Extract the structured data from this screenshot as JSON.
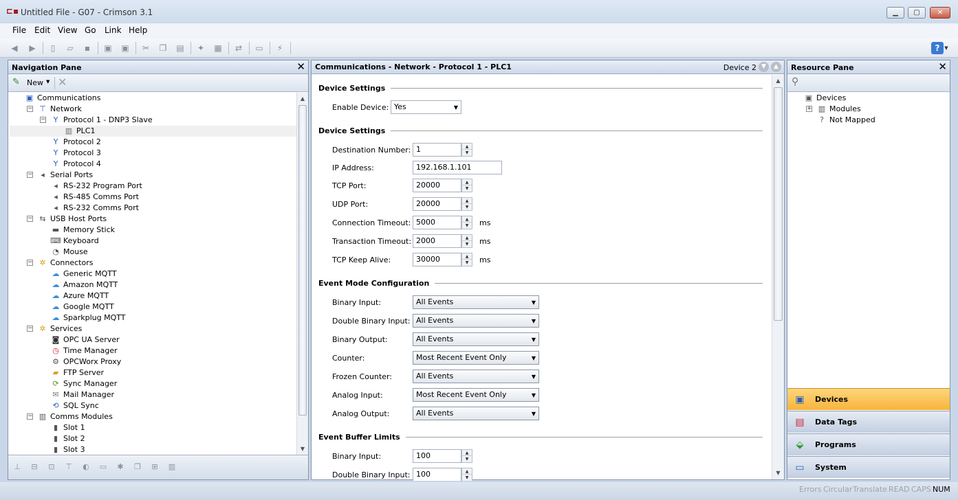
{
  "window": {
    "title": "Untitled File - G07 - Crimson 3.1",
    "app_icon": "crimson-app-icon",
    "controls": {
      "minimize": "▁",
      "maximize": "▢",
      "close": "✕"
    }
  },
  "menu": [
    "File",
    "Edit",
    "View",
    "Go",
    "Link",
    "Help"
  ],
  "toolbar": {
    "icons": [
      "back-icon",
      "forward-icon",
      "new-file-icon",
      "open-file-icon",
      "save-icon",
      "import-icon",
      "export-icon",
      "cut-icon",
      "copy-icon",
      "paste-icon",
      "find-icon",
      "print-icon",
      "link-icon",
      "window-icon",
      "wand-icon"
    ],
    "help_label": "?"
  },
  "nav": {
    "title": "Navigation Pane",
    "new_label": "New",
    "tree": [
      {
        "label": "Communications",
        "level": 0,
        "toggle": "",
        "icon": "communications-icon"
      },
      {
        "label": "Network",
        "level": 1,
        "toggle": "−",
        "icon": "network-icon"
      },
      {
        "label": "Protocol 1 - DNP3 Slave",
        "level": 2,
        "toggle": "−",
        "icon": "protocol-icon"
      },
      {
        "label": "PLC1",
        "level": 3,
        "toggle": "",
        "icon": "plc-icon",
        "selected": true
      },
      {
        "label": "Protocol 2",
        "level": 2,
        "toggle": "",
        "icon": "protocol-icon"
      },
      {
        "label": "Protocol 3",
        "level": 2,
        "toggle": "",
        "icon": "protocol-icon"
      },
      {
        "label": "Protocol 4",
        "level": 2,
        "toggle": "",
        "icon": "protocol-icon"
      },
      {
        "label": "Serial Ports",
        "level": 1,
        "toggle": "−",
        "icon": "serial-ports-icon"
      },
      {
        "label": "RS-232 Program Port",
        "level": 2,
        "toggle": "",
        "icon": "serial-port-icon"
      },
      {
        "label": "RS-485 Comms Port",
        "level": 2,
        "toggle": "",
        "icon": "serial-port-icon"
      },
      {
        "label": "RS-232 Comms Port",
        "level": 2,
        "toggle": "",
        "icon": "serial-port-icon"
      },
      {
        "label": "USB Host Ports",
        "level": 1,
        "toggle": "−",
        "icon": "usb-icon"
      },
      {
        "label": "Memory Stick",
        "level": 2,
        "toggle": "",
        "icon": "memory-stick-icon"
      },
      {
        "label": "Keyboard",
        "level": 2,
        "toggle": "",
        "icon": "keyboard-icon"
      },
      {
        "label": "Mouse",
        "level": 2,
        "toggle": "",
        "icon": "mouse-icon"
      },
      {
        "label": "Connectors",
        "level": 1,
        "toggle": "−",
        "icon": "connectors-icon"
      },
      {
        "label": "Generic MQTT",
        "level": 2,
        "toggle": "",
        "icon": "cloud-icon"
      },
      {
        "label": "Amazon MQTT",
        "level": 2,
        "toggle": "",
        "icon": "cloud-icon"
      },
      {
        "label": "Azure MQTT",
        "level": 2,
        "toggle": "",
        "icon": "cloud-icon"
      },
      {
        "label": "Google MQTT",
        "level": 2,
        "toggle": "",
        "icon": "cloud-icon"
      },
      {
        "label": "Sparkplug MQTT",
        "level": 2,
        "toggle": "",
        "icon": "cloud-icon"
      },
      {
        "label": "Services",
        "level": 1,
        "toggle": "−",
        "icon": "services-icon"
      },
      {
        "label": "OPC UA Server",
        "level": 2,
        "toggle": "",
        "icon": "opc-ua-icon"
      },
      {
        "label": "Time Manager",
        "level": 2,
        "toggle": "",
        "icon": "time-manager-icon"
      },
      {
        "label": "OPCWorx Proxy",
        "level": 2,
        "toggle": "",
        "icon": "opcworx-icon"
      },
      {
        "label": "FTP Server",
        "level": 2,
        "toggle": "",
        "icon": "ftp-icon"
      },
      {
        "label": "Sync Manager",
        "level": 2,
        "toggle": "",
        "icon": "sync-icon"
      },
      {
        "label": "Mail Manager",
        "level": 2,
        "toggle": "",
        "icon": "mail-icon"
      },
      {
        "label": "SQL Sync",
        "level": 2,
        "toggle": "",
        "icon": "sql-sync-icon"
      },
      {
        "label": "Comms Modules",
        "level": 1,
        "toggle": "−",
        "icon": "comms-modules-icon"
      },
      {
        "label": "Slot 1",
        "level": 2,
        "toggle": "",
        "icon": "slot-icon"
      },
      {
        "label": "Slot 2",
        "level": 2,
        "toggle": "",
        "icon": "slot-icon"
      },
      {
        "label": "Slot 3",
        "level": 2,
        "toggle": "",
        "icon": "slot-icon"
      }
    ]
  },
  "center": {
    "title": "Communications - Network - Protocol 1 - PLC1",
    "device_label": "Device 2",
    "sections": {
      "s1": "Device Settings",
      "s2": "Device Settings",
      "s3": "Event Mode Configuration",
      "s4": "Event Buffer Limits"
    },
    "enable_device": {
      "label": "Enable Device:",
      "value": "Yes"
    },
    "destination": {
      "label": "Destination Number:",
      "value": "1"
    },
    "ip": {
      "label": "IP Address:",
      "value": "192.168.1.101"
    },
    "tcp_port": {
      "label": "TCP Port:",
      "value": "20000"
    },
    "udp_port": {
      "label": "UDP Port:",
      "value": "20000"
    },
    "conn_timeout": {
      "label": "Connection Timeout:",
      "value": "5000",
      "unit": "ms"
    },
    "trans_timeout": {
      "label": "Transaction Timeout:",
      "value": "2000",
      "unit": "ms"
    },
    "keep_alive": {
      "label": "TCP Keep Alive:",
      "value": "30000",
      "unit": "ms"
    },
    "events": {
      "binary_input": {
        "label": "Binary Input:",
        "value": "All Events"
      },
      "double_binary_input": {
        "label": "Double Binary Input:",
        "value": "All Events"
      },
      "binary_output": {
        "label": "Binary Output:",
        "value": "All Events"
      },
      "counter": {
        "label": "Counter:",
        "value": "Most Recent Event Only"
      },
      "frozen_counter": {
        "label": "Frozen Counter:",
        "value": "All Events"
      },
      "analog_input": {
        "label": "Analog Input:",
        "value": "Most Recent Event Only"
      },
      "analog_output": {
        "label": "Analog Output:",
        "value": "All Events"
      }
    },
    "buffer": {
      "binary_input": {
        "label": "Binary Input:",
        "value": "100"
      },
      "double_binary_input": {
        "label": "Double Binary Input:",
        "value": "100"
      }
    }
  },
  "resource": {
    "title": "Resource Pane",
    "tree": [
      {
        "label": "Devices",
        "level": 0,
        "toggle": "",
        "icon": "devices-icon"
      },
      {
        "label": "Modules",
        "level": 1,
        "toggle": "+",
        "icon": "modules-icon"
      },
      {
        "label": "Not Mapped",
        "level": 1,
        "toggle": "",
        "icon": "not-mapped-icon"
      }
    ],
    "categories": [
      {
        "label": "Devices",
        "icon": "devices-category-icon",
        "active": true
      },
      {
        "label": "Data Tags",
        "icon": "data-tags-icon",
        "active": false
      },
      {
        "label": "Programs",
        "icon": "programs-icon",
        "active": false
      },
      {
        "label": "System",
        "icon": "system-icon",
        "active": false
      }
    ]
  },
  "status": {
    "items": [
      "Errors",
      "Circular",
      "Translate",
      "READ",
      "CAPS",
      "NUM"
    ],
    "active": "NUM"
  }
}
